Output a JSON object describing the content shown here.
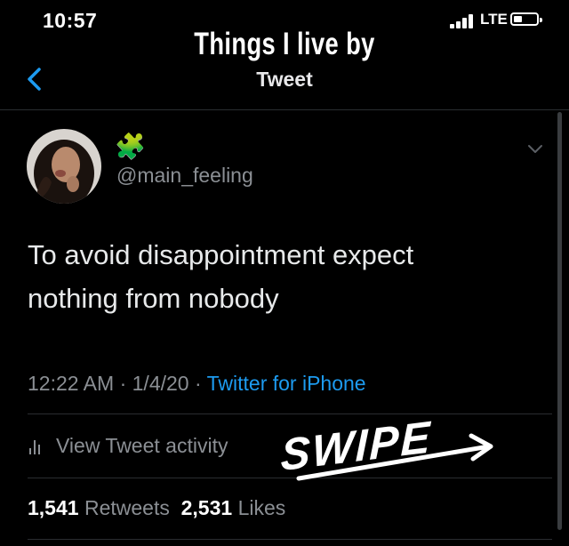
{
  "status_bar": {
    "time": "10:57",
    "network": "LTE",
    "battery_level": 0.3
  },
  "overlay": {
    "title": "Things I live by",
    "swipe_label": "SWIPE"
  },
  "nav": {
    "title": "Tweet"
  },
  "tweet": {
    "badge_emoji": "🧩",
    "handle": "@main_feeling",
    "text_line1": "To avoid disappointment expect",
    "text_line2": "nothing from nobody",
    "time": "12:22 AM",
    "date": "1/4/20",
    "separator": " · ",
    "source": "Twitter for iPhone",
    "activity_label": "View Tweet activity",
    "retweets_count": "1,541",
    "retweets_label": "Retweets",
    "likes_count": "2,531",
    "likes_label": "Likes"
  },
  "colors": {
    "background": "#000000",
    "accent": "#1d9bf0",
    "muted": "#8b8f94",
    "divider": "#2a2d30"
  }
}
